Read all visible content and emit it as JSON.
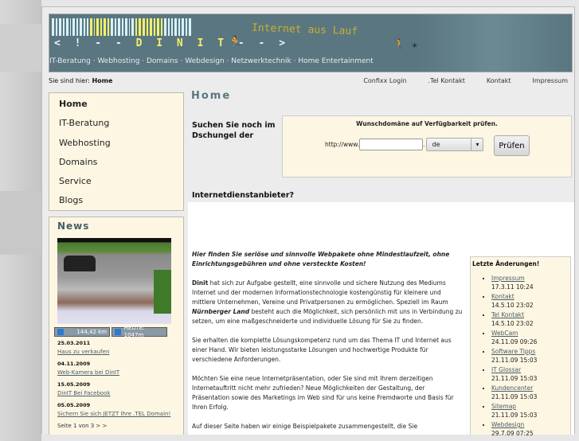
{
  "header": {
    "logo": "<!-- DINIT -->",
    "logo_prefix": "< ! - -",
    "logo_main": "D I N I T",
    "logo_suffix": "- - >",
    "slogan": "Internet aus Lauf",
    "nav": [
      "IT-Beratung",
      "Webhosting",
      "Domains",
      "Webdesign",
      "Netzwerktechnik",
      "Home Entertainment"
    ],
    "nav_separator": " · "
  },
  "breadcrumb": {
    "label": "Sie sind hier:",
    "current": "Home"
  },
  "toplinks": [
    "Confixx Login",
    ".Tel Kontakt",
    "Kontakt",
    "Impressum"
  ],
  "sidebar": {
    "items": [
      "Home",
      "IT-Beratung",
      "Webhosting",
      "Domains",
      "Service",
      "Blogs"
    ],
    "active": "Home"
  },
  "news": {
    "title": "News",
    "counter_total": "144,42 km",
    "counter_today": "HEUTE:  1047m",
    "items": [
      {
        "date": "25.03.2011",
        "title": "Haus zu verkaufen"
      },
      {
        "date": "04.11.2009",
        "title": "Web-Kamera bei DinIT"
      },
      {
        "date": "15.05.2009",
        "title": "DinIT Bei Facebook"
      },
      {
        "date": "05.05.2009",
        "title": "Sichern Sie sich JETZT Ihre .TEL Domain!"
      }
    ],
    "pager": "Seite 1 von 3 > >"
  },
  "main": {
    "title": "Home",
    "question_1": "Suchen Sie noch im Dschungel der",
    "question_2": "Internetdienstanbieter?",
    "domain_check": {
      "title": "Wunschdomäne auf Verfügbarkeit prüfen.",
      "prefix": "http://www.",
      "value": "",
      "dot": ".",
      "tld": "de",
      "button": "Prüfen"
    },
    "lead": "Hier finden Sie seriöse und sinnvolle Webpakete ohne Mindestlaufzeit, ohne Einrichtungsgebühren und ohne versteckte Kosten!",
    "p1_brand": "Dinit",
    "p1_a": " hat sich zur Aufgabe gestellt, eine sinnvolle und sichere Nutzung des Mediums Internet und der modernen Informationstechnologie kostengünstig für kleinere und mittlere Unternehmen, Vereine und Privatpersonen zu ermöglichen. Speziell im Raum ",
    "p1_region": "Nürnberger Land",
    "p1_b": " besteht auch die Möglichkeit, sich persönlich mit uns in Verbindung zu setzen, um eine maßgeschneiderte und individuelle Lösung für Sie zu finden.",
    "p2": "Sie erhalten die komplette Lösungskompetenz rund um das Thema IT und Internet aus einer Hand. Wir bieten leistungsstarke Lösungen und hochwertige Produkte für verschiedene Anforderungen.",
    "p3": "Möchten Sie eine neue Internetpräsentation, oder Sie sind mit Ihrem derzeitigen Internetauftritt nicht mehr zufrieden? Neue Möglichkeiten der Gestaltung, der Präsentation sowie des Marketings im Web sind für uns keine Fremdworte und Basis für Ihren Erfolg.",
    "p4": "Auf dieser Seite haben wir einige Beispielpakete zusammengestellt, die Sie"
  },
  "changes": {
    "title": "Letzte Änderungen!",
    "items": [
      {
        "title": "Impressum",
        "date": "17.3.11 10:24"
      },
      {
        "title": "Kontakt",
        "date": "14.5.10 23:02"
      },
      {
        "title": "Tel Kontakt",
        "date": "14.5.10 23:02"
      },
      {
        "title": "WebCam",
        "date": "24.11.09 09:26"
      },
      {
        "title": "Software Tipps",
        "date": "21.11.09 15:03"
      },
      {
        "title": "IT Glossar",
        "date": "21.11.09 15:03"
      },
      {
        "title": "Kundencenter",
        "date": "21.11.09 15:03"
      },
      {
        "title": "Sitemap",
        "date": "21.11.09 15:03"
      },
      {
        "title": "Webdesign",
        "date": "29.7.09 07:25"
      }
    ]
  }
}
